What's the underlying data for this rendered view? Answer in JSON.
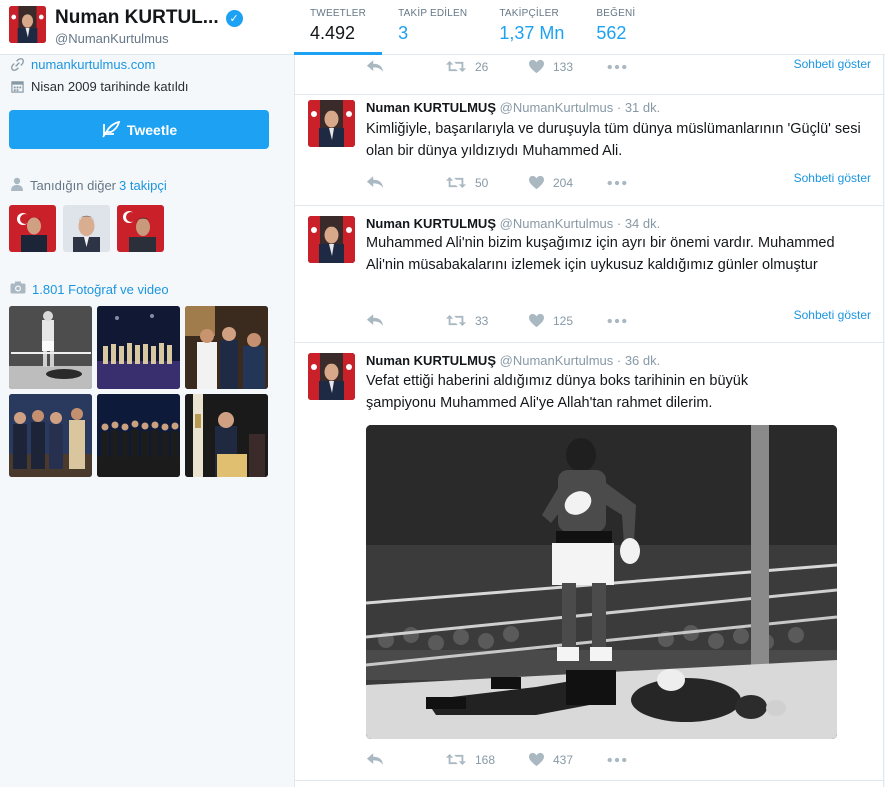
{
  "profile": {
    "name": "Numan KURTUL...",
    "handle": "@NumanKurtulmus",
    "website": "numankurtulmus.com",
    "joined": "Nisan 2009 tarihinde katıldı",
    "tweet_button": "Tweetle",
    "followers_you_know_prefix": "Tanıdığın diğer ",
    "followers_you_know_link": "3 takipçi",
    "media_link": "1.801 Fotoğraf ve video"
  },
  "stats": [
    {
      "label": "TWEETLER",
      "value": "4.492"
    },
    {
      "label": "TAKİP EDİLEN",
      "value": "3"
    },
    {
      "label": "TAKİPÇİLER",
      "value": "1,37 Mn"
    },
    {
      "label": "BEĞENİ",
      "value": "562"
    }
  ],
  "timeline": {
    "top_partial": {
      "retweets": "26",
      "likes": "133",
      "conversation": "Sohbeti göster"
    },
    "tweets": [
      {
        "name": "Numan KURTULMUŞ",
        "handle": "@NumanKurtulmus",
        "time": "· 31 dk.",
        "text": "Kimliğiyle, başarılarıyla ve duruşuyla tüm dünya müslümanlarının 'Güçlü' sesi olan bir dünya yıldızıydı Muhammed Ali.",
        "retweets": "50",
        "likes": "204",
        "conversation": "Sohbeti göster"
      },
      {
        "name": "Numan KURTULMUŞ",
        "handle": "@NumanKurtulmus",
        "time": "· 34 dk.",
        "text": "Muhammed Ali'nin bizim kuşağımız için ayrı bir önemi vardır. Muhammed Ali'nin müsabakalarını izlemek için uykusuz kaldığımız günler olmuştur",
        "retweets": "33",
        "likes": "125",
        "conversation": "Sohbeti göster"
      },
      {
        "name": "Numan KURTULMUŞ",
        "handle": "@NumanKurtulmus",
        "time": "· 36 dk.",
        "text": "Vefat ettiği haberini aldığımız dünya boks tarihinin en büyük şampiyonu Muhammed Ali'ye Allah'tan rahmet dilerim.",
        "retweets": "168",
        "likes": "437",
        "conversation": ""
      }
    ]
  },
  "colors": {
    "accent": "#1da1f2",
    "link": "#1b95e0",
    "muted": "#8899a6",
    "background": "#f5f8fa",
    "border": "#e1e8ed"
  },
  "icons": [
    "verified-badge-icon",
    "link-icon",
    "calendar-icon",
    "quill-icon",
    "person-icon",
    "camera-icon",
    "reply-icon",
    "retweet-icon",
    "heart-icon",
    "more-icon"
  ]
}
